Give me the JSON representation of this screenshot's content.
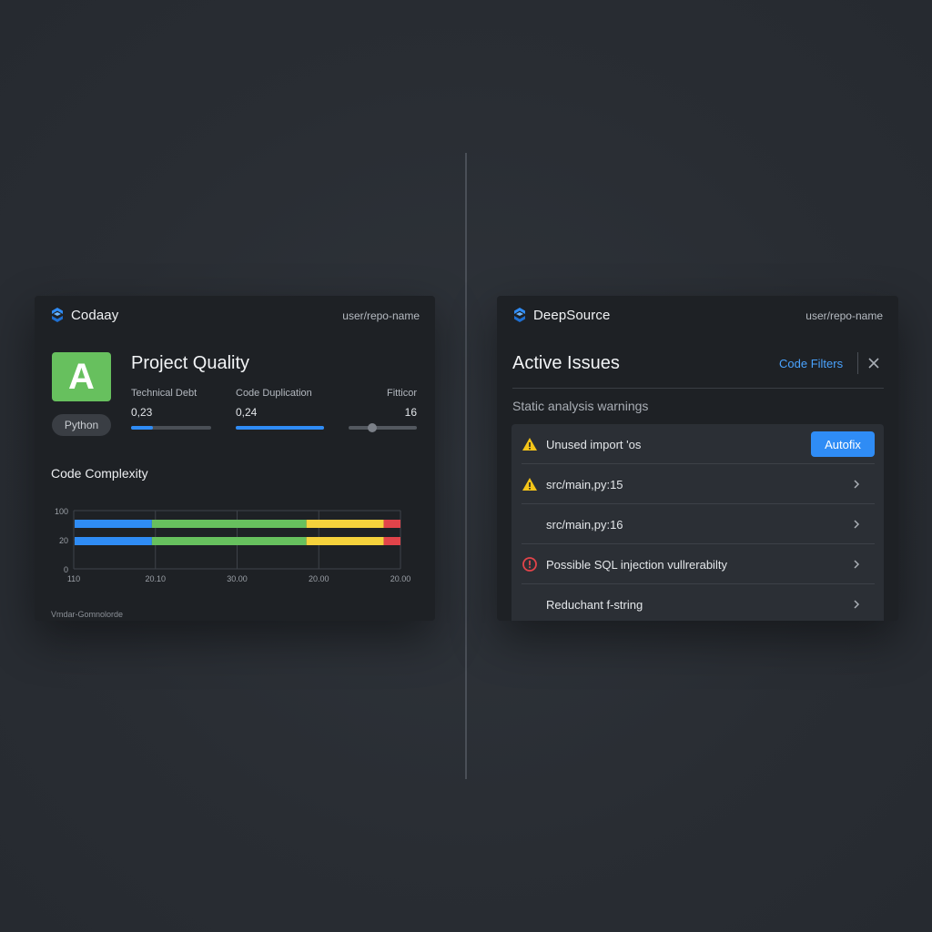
{
  "colors": {
    "accent": "#2f8cf5",
    "grade_green": "#67c05e",
    "warning": "#f5c518",
    "error": "#e2444a",
    "bar_blue": "#2f8cf5",
    "bar_green": "#67c05e",
    "bar_yellow": "#f5d23c",
    "bar_red": "#e2444a"
  },
  "left": {
    "brand": "Codaay",
    "logo_icon": "hex-logo-icon",
    "repo": "user/repo-name",
    "grade": "A",
    "language": "Python",
    "title": "Project Quality",
    "metrics": [
      {
        "label": "Technical Debt",
        "value": "0,23",
        "progress": 0.27
      },
      {
        "label": "Code Duplication",
        "value": "0,24",
        "progress": 1.0
      },
      {
        "label": "Fitticor",
        "value": "16",
        "progress": 0.35
      }
    ],
    "complexity_title": "Code Complexity",
    "footnote": "Vmdar-Gomnolorde"
  },
  "chart_data": {
    "type": "bar",
    "orientation": "horizontal-stacked",
    "y_ticks": [
      "100",
      "20",
      "0"
    ],
    "x_ticks": [
      "110",
      "20.10",
      "30.00",
      "20.00",
      "20.00"
    ],
    "segment_colors": [
      "#2f8cf5",
      "#67c05e",
      "#f5d23c",
      "#e2444a"
    ],
    "rows": [
      {
        "segments": [
          23,
          46,
          23,
          5
        ]
      },
      {
        "segments": [
          23,
          46,
          23,
          5
        ]
      }
    ],
    "grid": true
  },
  "right": {
    "brand": "DeepSource",
    "logo_icon": "hex-logo-icon",
    "repo": "user/repo-name",
    "title": "Active Issues",
    "filters_label": "Code Filters",
    "close_icon": "close-icon",
    "subheading": "Static analysis warnings",
    "autofix_label": "Autofix",
    "issues": [
      {
        "severity": "warning",
        "text": "Unused import 'os",
        "action": "autofix"
      },
      {
        "severity": "warning",
        "text": "src/main,py:15",
        "action": "chevron"
      },
      {
        "severity": "none",
        "text": "src/main,py:16",
        "action": "chevron"
      },
      {
        "severity": "error",
        "text": "Possible SQL injection vullrerabilty",
        "action": "chevron"
      },
      {
        "severity": "none",
        "text": "Reduchant f-string",
        "action": "chevron"
      }
    ]
  }
}
